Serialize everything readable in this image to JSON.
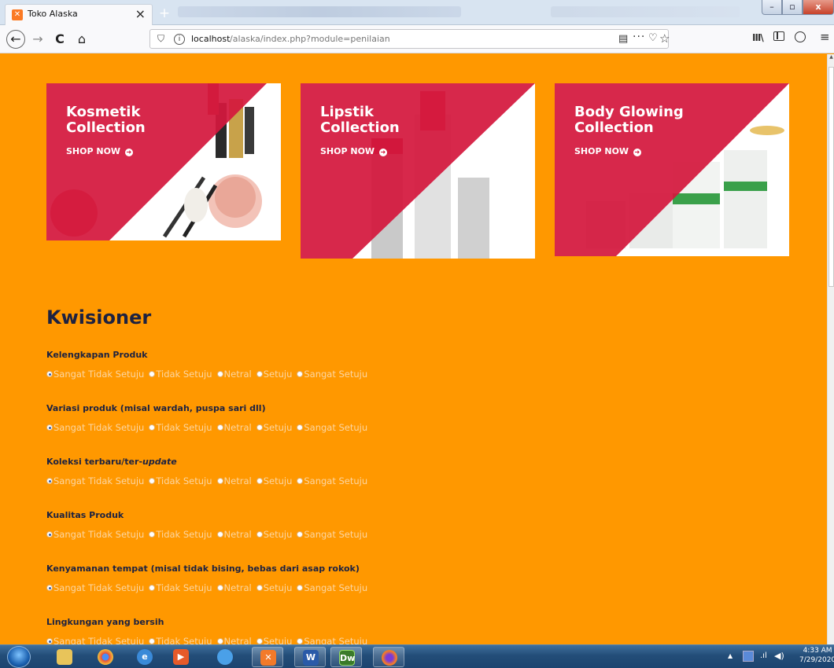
{
  "browser": {
    "tab_title": "Toko Alaska",
    "url_host": "localhost",
    "url_path": "/alaska/index.php?module=penilaian"
  },
  "banners": [
    {
      "title_line1": "Kosmetik",
      "title_line2": "Collection",
      "cta": "SHOP NOW"
    },
    {
      "title_line1": "Lipstik",
      "title_line2": "Collection",
      "cta": "SHOP NOW"
    },
    {
      "title_line1": "Body Glowing",
      "title_line2": "Collection",
      "cta": "SHOP NOW"
    }
  ],
  "colors": {
    "page_bg": "#ff9800",
    "banner_red": "#d4183d",
    "heading": "#1d2240"
  },
  "questionnaire": {
    "title": "Kwisioner",
    "options": [
      "Sangat Tidak Setuju",
      "Tidak Setuju",
      "Netral",
      "Setuju",
      "Sangat Setuju"
    ],
    "questions": [
      {
        "label": "Kelengkapan Produk",
        "selected": 0
      },
      {
        "label": "Variasi produk (misal wardah, puspa sari dll)",
        "selected": 0
      },
      {
        "label_prefix": "Koleksi terbaru/ter-",
        "label_emphasis": "update",
        "selected": 0
      },
      {
        "label": "Kualitas Produk",
        "selected": 0
      },
      {
        "label": "Kenyamanan tempat (misal tidak bising, bebas dari asap rokok)",
        "selected": 0
      },
      {
        "label": "Lingkungan yang bersih",
        "selected": 0
      }
    ]
  },
  "taskbar": {
    "time": "4:33 AM",
    "date": "7/29/2020"
  }
}
